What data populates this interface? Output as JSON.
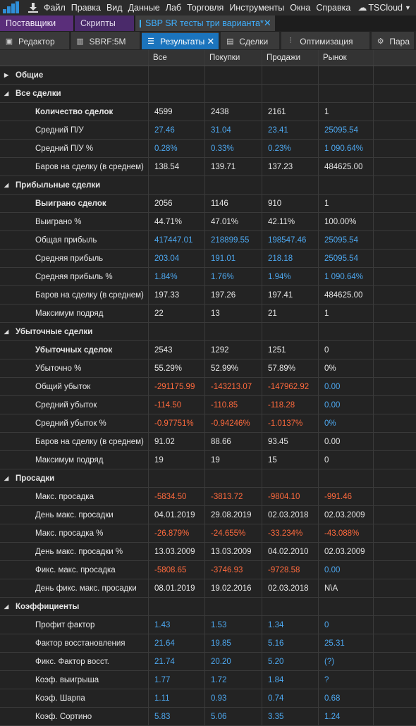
{
  "menubar": {
    "items": [
      "Файл",
      "Правка",
      "Вид",
      "Данные",
      "Лаб",
      "Торговля",
      "Инструменты",
      "Окна",
      "Справка"
    ],
    "cloud": "TSCloud"
  },
  "doc_tabs": [
    "Поставщики",
    "Скрипты",
    "SBP SR тесты три варианта*"
  ],
  "tool_tabs": [
    "Редактор",
    "SBRF:5M",
    "Результаты",
    "Сделки",
    "Оптимизация",
    "Пара"
  ],
  "columns": [
    "",
    "Все",
    "Покупки",
    "Продажи",
    "Рынок",
    ""
  ],
  "colors": {
    "blue": "#4da8f0",
    "red": "#ff6a3d",
    "accent": "#1b74bd"
  },
  "sections": [
    {
      "title": "Общие",
      "expanded": false,
      "rows": []
    },
    {
      "title": "Все сделки",
      "expanded": true,
      "rows": [
        {
          "label": "Количество сделок",
          "bold": true,
          "values": [
            "4599",
            "2438",
            "2161",
            "1"
          ],
          "color": "white"
        },
        {
          "label": "Средний П/У",
          "values": [
            "27.46",
            "31.04",
            "23.41",
            "25095.54"
          ],
          "color": "blue"
        },
        {
          "label": "Средний П/У %",
          "values": [
            "0.28%",
            "0.33%",
            "0.23%",
            "1 090.64%"
          ],
          "color": "blue"
        },
        {
          "label": "Баров на сделку (в среднем)",
          "values": [
            "138.54",
            "139.71",
            "137.23",
            "484625.00"
          ],
          "color": "white"
        }
      ]
    },
    {
      "title": "Прибыльные сделки",
      "expanded": true,
      "rows": [
        {
          "label": "Выиграно сделок",
          "bold": true,
          "values": [
            "2056",
            "1146",
            "910",
            "1"
          ],
          "color": "white"
        },
        {
          "label": "Выиграно %",
          "values": [
            "44.71%",
            "47.01%",
            "42.11%",
            "100.00%"
          ],
          "color": "white"
        },
        {
          "label": "Общая прибыль",
          "values": [
            "417447.01",
            "218899.55",
            "198547.46",
            "25095.54"
          ],
          "color": "blue"
        },
        {
          "label": "Средняя прибыль",
          "values": [
            "203.04",
            "191.01",
            "218.18",
            "25095.54"
          ],
          "color": "blue"
        },
        {
          "label": "Средняя прибыль %",
          "values": [
            "1.84%",
            "1.76%",
            "1.94%",
            "1 090.64%"
          ],
          "color": "blue"
        },
        {
          "label": "Баров на сделку (в среднем)",
          "values": [
            "197.33",
            "197.26",
            "197.41",
            "484625.00"
          ],
          "color": "white"
        },
        {
          "label": "Максимум подряд",
          "values": [
            "22",
            "13",
            "21",
            "1"
          ],
          "color": "white"
        }
      ]
    },
    {
      "title": "Убыточные сделки",
      "expanded": true,
      "rows": [
        {
          "label": "Убыточных сделок",
          "bold": true,
          "values": [
            "2543",
            "1292",
            "1251",
            "0"
          ],
          "color": "white"
        },
        {
          "label": "Убыточно %",
          "values": [
            "55.29%",
            "52.99%",
            "57.89%",
            "0%"
          ],
          "color": "white"
        },
        {
          "label": "Общий убыток",
          "values": [
            "-291175.99",
            "-143213.07",
            "-147962.92",
            "0.00"
          ],
          "color": "red",
          "last_color": "blue"
        },
        {
          "label": "Средний убыток",
          "values": [
            "-114.50",
            "-110.85",
            "-118.28",
            "0.00"
          ],
          "color": "red",
          "last_color": "blue"
        },
        {
          "label": "Средний убыток %",
          "values": [
            "-0.97751%",
            "-0.94246%",
            "-1.0137%",
            "0%"
          ],
          "color": "red",
          "last_color": "blue"
        },
        {
          "label": "Баров на сделку (в среднем)",
          "values": [
            "91.02",
            "88.66",
            "93.45",
            "0.00"
          ],
          "color": "white"
        },
        {
          "label": "Максимум подряд",
          "values": [
            "19",
            "19",
            "15",
            "0"
          ],
          "color": "white"
        }
      ]
    },
    {
      "title": "Просадки",
      "expanded": true,
      "rows": [
        {
          "label": "Макс. просадка",
          "values": [
            "-5834.50",
            "-3813.72",
            "-9804.10",
            "-991.46"
          ],
          "color": "red"
        },
        {
          "label": "День макс. просадки",
          "values": [
            "04.01.2019",
            "29.08.2019",
            "02.03.2018",
            "02.03.2009"
          ],
          "color": "white"
        },
        {
          "label": "Макс. просадка %",
          "values": [
            "-26.879%",
            "-24.655%",
            "-33.234%",
            "-43.088%"
          ],
          "color": "red"
        },
        {
          "label": "День макс. просадки %",
          "values": [
            "13.03.2009",
            "13.03.2009",
            "04.02.2010",
            "02.03.2009"
          ],
          "color": "white"
        },
        {
          "label": "Фикс. макс. просадка",
          "values": [
            "-5808.65",
            "-3746.93",
            "-9728.58",
            "0.00"
          ],
          "color": "red",
          "last_color": "blue"
        },
        {
          "label": "День фикс. макс. просадки",
          "values": [
            "08.01.2019",
            "19.02.2016",
            "02.03.2018",
            "N\\A"
          ],
          "color": "white"
        }
      ]
    },
    {
      "title": "Коэффициенты",
      "expanded": true,
      "rows": [
        {
          "label": "Профит фактор",
          "values": [
            "1.43",
            "1.53",
            "1.34",
            "0"
          ],
          "color": "blue"
        },
        {
          "label": "Фактор восстановления",
          "values": [
            "21.64",
            "19.85",
            "5.16",
            "25.31"
          ],
          "color": "blue"
        },
        {
          "label": "Фикс. Фактор восст.",
          "values": [
            "21.74",
            "20.20",
            "5.20",
            "(?)"
          ],
          "color": "blue"
        },
        {
          "label": "Коэф. выигрыша",
          "values": [
            "1.77",
            "1.72",
            "1.84",
            "?"
          ],
          "color": "blue"
        },
        {
          "label": "Коэф. Шарпа",
          "values": [
            "1.11",
            "0.93",
            "0.74",
            "0.68"
          ],
          "color": "blue"
        },
        {
          "label": "Коэф. Сортино",
          "values": [
            "5.83",
            "5.06",
            "3.35",
            "1.24"
          ],
          "color": "blue"
        }
      ]
    }
  ]
}
